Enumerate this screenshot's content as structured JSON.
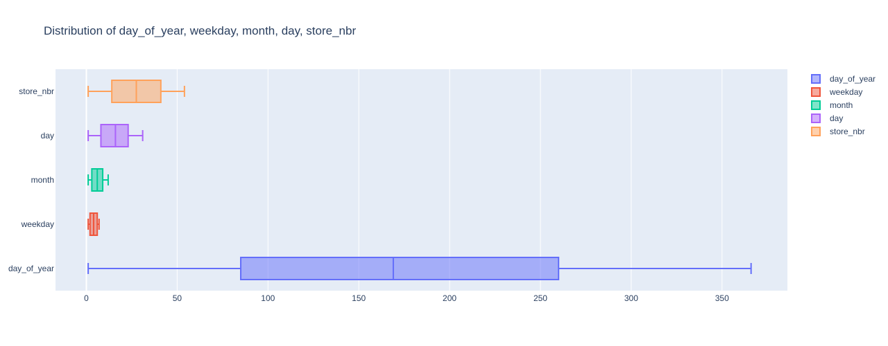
{
  "chart_data": {
    "type": "box",
    "orientation": "horizontal",
    "title": "Distribution of day_of_year, weekday, month, day, store_nbr",
    "xlabel": "",
    "ylabel": "",
    "xlim": [
      -17,
      386
    ],
    "x_ticks": [
      0,
      50,
      100,
      150,
      200,
      250,
      300,
      350
    ],
    "grid": true,
    "legend_placement": "top-right",
    "plot_background": "#e5ecf6",
    "series": [
      {
        "name": "day_of_year",
        "color": "#636efa",
        "min": 1,
        "q1": 85,
        "median": 169,
        "q3": 260,
        "max": 366
      },
      {
        "name": "weekday",
        "color": "#ef553b",
        "min": 1,
        "q1": 2,
        "median": 4,
        "q3": 6,
        "max": 7
      },
      {
        "name": "month",
        "color": "#00cc96",
        "min": 1,
        "q1": 3,
        "median": 6,
        "q3": 9,
        "max": 12
      },
      {
        "name": "day",
        "color": "#ab63fa",
        "min": 1,
        "q1": 8,
        "median": 16,
        "q3": 23,
        "max": 31
      },
      {
        "name": "store_nbr",
        "color": "#ffa15a",
        "min": 1,
        "q1": 14,
        "median": 27.5,
        "q3": 41,
        "max": 54
      }
    ]
  }
}
